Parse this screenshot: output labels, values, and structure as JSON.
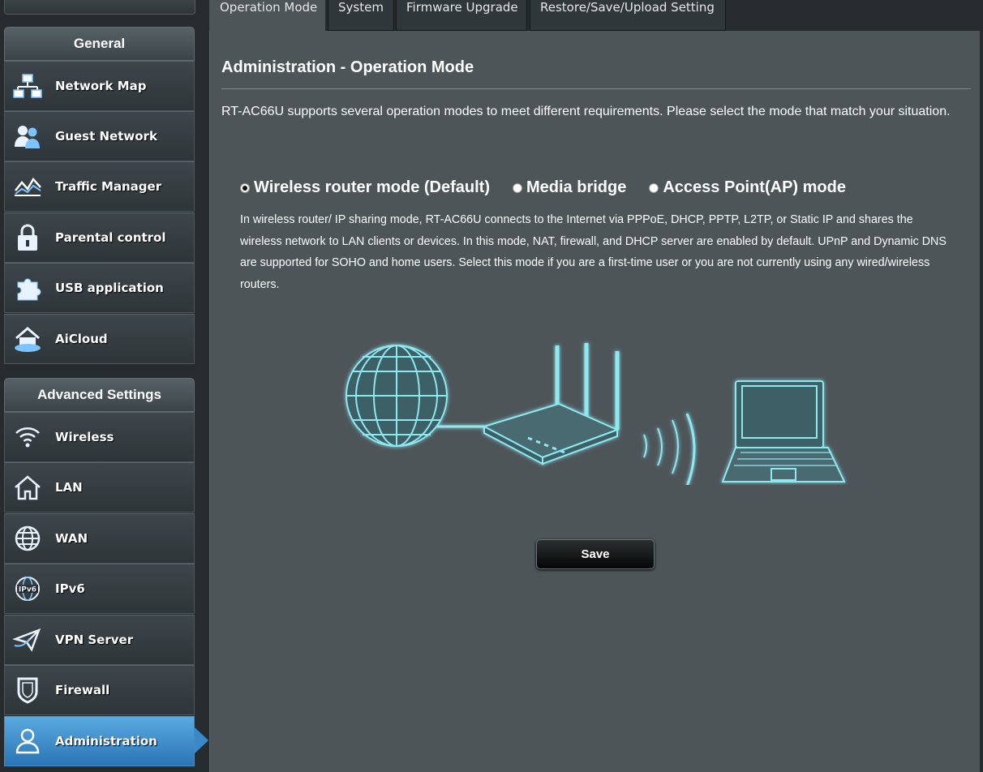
{
  "tabs": [
    "Operation Mode",
    "System",
    "Firmware Upgrade",
    "Restore/Save/Upload Setting"
  ],
  "sidebar": {
    "general_header": "General",
    "general_items": [
      {
        "label": "Network Map",
        "icon": "network-map-icon"
      },
      {
        "label": "Guest Network",
        "icon": "guest-network-icon"
      },
      {
        "label": "Traffic Manager",
        "icon": "traffic-manager-icon"
      },
      {
        "label": "Parental control",
        "icon": "lock-icon"
      },
      {
        "label": "USB application",
        "icon": "puzzle-icon"
      },
      {
        "label": "AiCloud",
        "icon": "cloud-house-icon"
      }
    ],
    "advanced_header": "Advanced Settings",
    "advanced_items": [
      {
        "label": "Wireless",
        "icon": "wifi-icon"
      },
      {
        "label": "LAN",
        "icon": "house-icon"
      },
      {
        "label": "WAN",
        "icon": "globe-icon"
      },
      {
        "label": "IPv6",
        "icon": "ipv6-icon"
      },
      {
        "label": "VPN Server",
        "icon": "vpn-icon"
      },
      {
        "label": "Firewall",
        "icon": "shield-icon"
      },
      {
        "label": "Administration",
        "icon": "admin-user-icon",
        "active": true
      }
    ]
  },
  "main": {
    "title": "Administration - Operation Mode",
    "intro": "RT-AC66U supports several operation modes to meet different requirements. Please select the mode that match your situation.",
    "modes": [
      {
        "label": "Wireless router mode (Default)",
        "selected": true
      },
      {
        "label": "Media bridge",
        "selected": false
      },
      {
        "label": "Access Point(AP) mode",
        "selected": false
      }
    ],
    "description": "In wireless router/ IP sharing mode, RT-AC66U connects to the Internet via PPPoE, DHCP, PPTP, L2TP, or Static IP and shares the wireless network to LAN clients or devices. In this mode, NAT, firewall, and DHCP server are enabled by default. UPnP and Dynamic DNS are supported for SOHO and home users. Select this mode if you are a first-time user or you are not currently using any wired/wireless routers.",
    "save_label": "Save"
  },
  "colors": {
    "panel_bg": "#4d5559",
    "active_item": "#3a88c8",
    "illustration_glow": "#8ee8f0"
  }
}
